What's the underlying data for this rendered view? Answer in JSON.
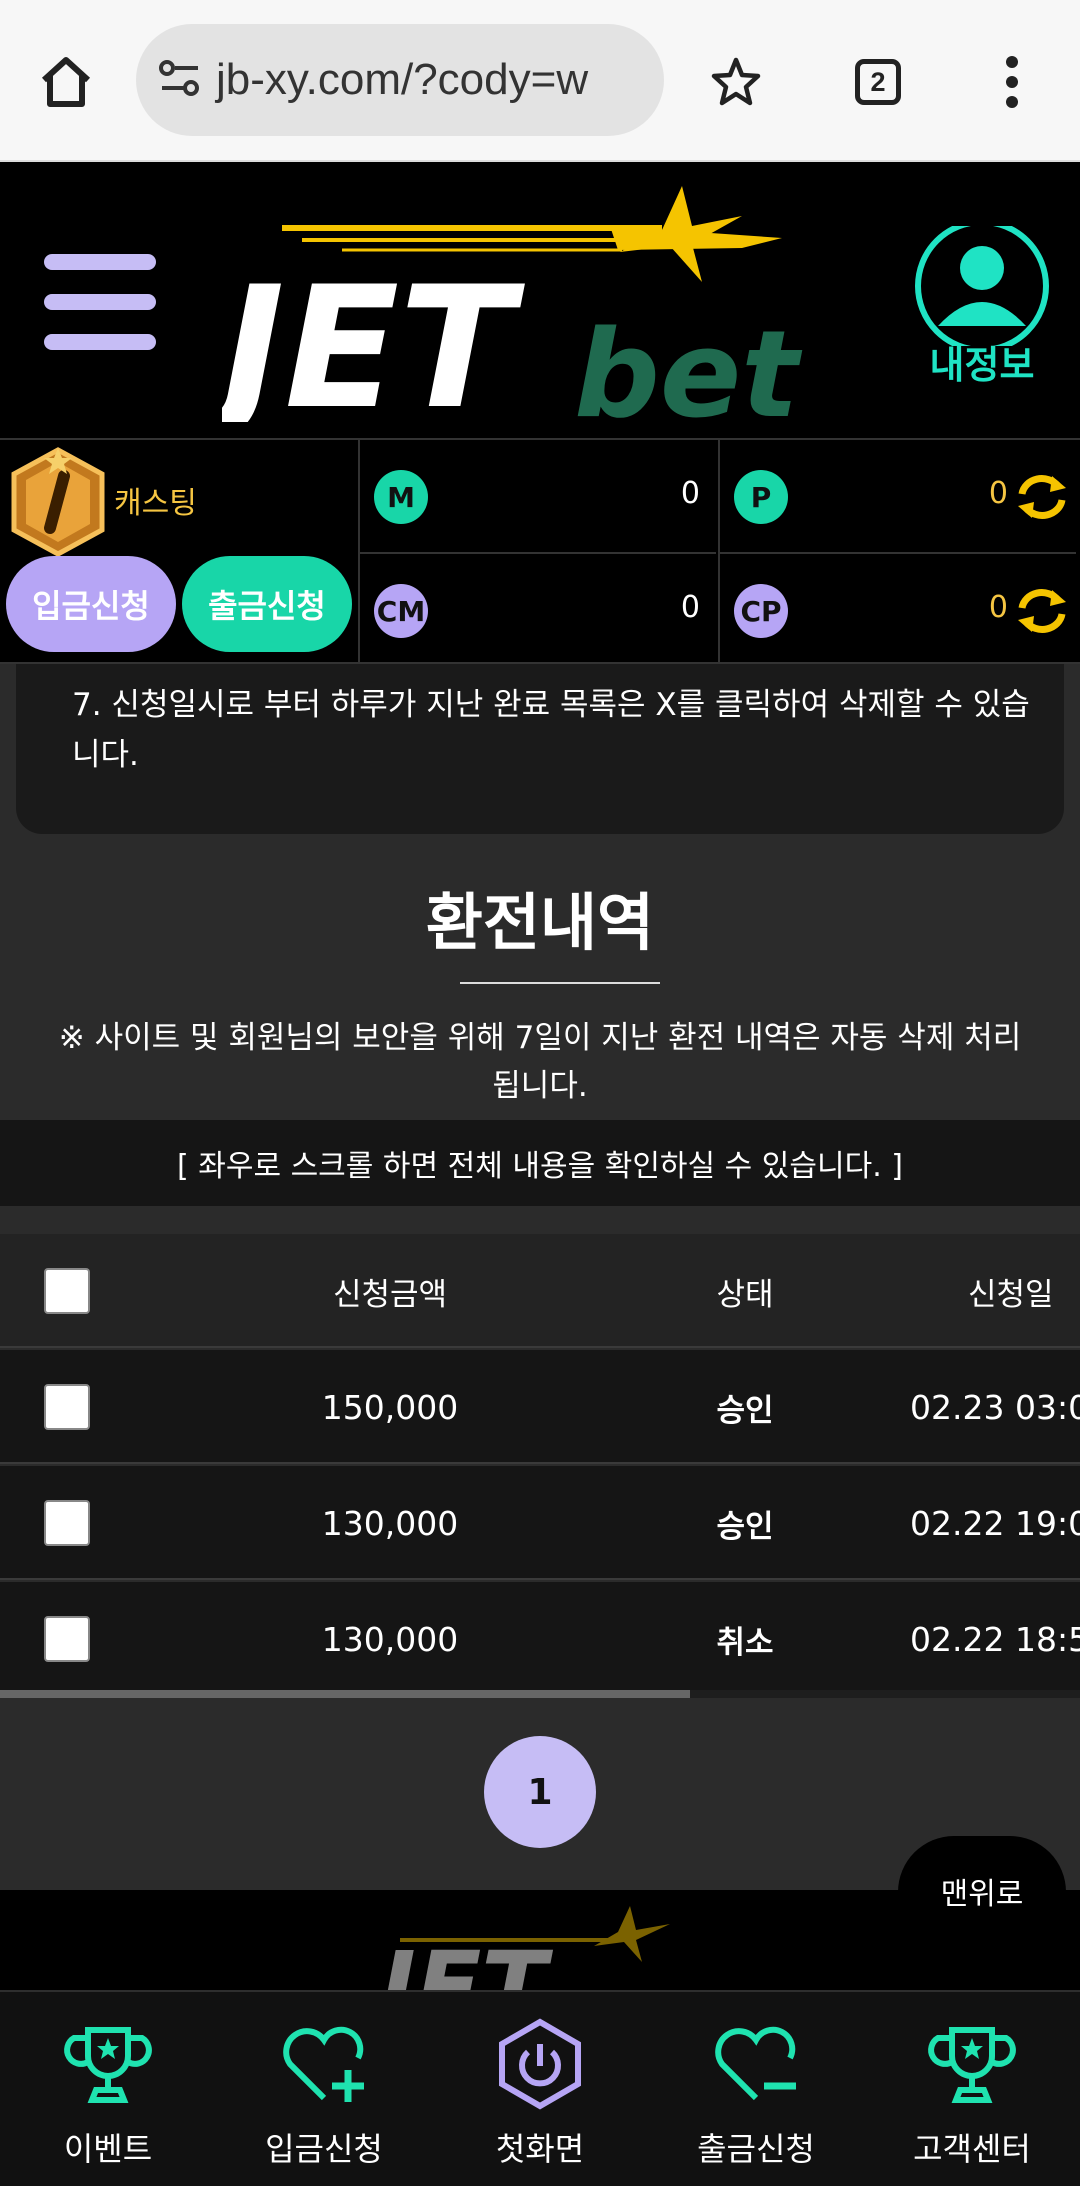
{
  "browser": {
    "url": "jb-xy.com/?cody=w",
    "tab_count": "2",
    "icons": [
      "home-icon",
      "site-info-icon",
      "star-icon",
      "tabs-icon",
      "more-icon"
    ]
  },
  "header": {
    "logo_text_main": "JET",
    "logo_text_sub": "bet",
    "profile_label": "내정보"
  },
  "user_bar": {
    "rank_label": "캐스팅",
    "deposit_button": "입금신청",
    "withdraw_button": "출금신청",
    "balances": [
      {
        "code": "M",
        "value": "0"
      },
      {
        "code": "P",
        "value": "0"
      },
      {
        "code": "CM",
        "value": "0"
      },
      {
        "code": "CP",
        "value": "0"
      }
    ]
  },
  "notice": {
    "text": "7. 신청일시로 부터 하루가 지난 완료 목록은 X를 클릭하여 삭제할 수 있습니다."
  },
  "section": {
    "title": "환전내역",
    "security_note": "※ 사이트 및 회원님의 보안을 위해 7일이 지난 환전 내역은 자동 삭제 처리 됩니다.",
    "scroll_notice": "[ 좌우로 스크롤 하면 전체 내용을 확인하실 수 있습니다. ]"
  },
  "table": {
    "headers": {
      "amount": "신청금액",
      "status": "상태",
      "date": "신청일"
    },
    "rows": [
      {
        "amount": "150,000",
        "status": "승인",
        "date": "02.23 03:0"
      },
      {
        "amount": "130,000",
        "status": "승인",
        "date": "02.22 19:0"
      },
      {
        "amount": "130,000",
        "status": "취소",
        "date": "02.22 18:5"
      }
    ]
  },
  "pagination": {
    "current": "1"
  },
  "to_top_label": "맨위로",
  "bottom_nav": [
    {
      "label": "이벤트",
      "icon": "trophy-icon"
    },
    {
      "label": "입금신청",
      "icon": "heart-plus-icon"
    },
    {
      "label": "첫화면",
      "icon": "power-icon"
    },
    {
      "label": "출금신청",
      "icon": "heart-minus-icon"
    },
    {
      "label": "고객센터",
      "icon": "trophy-icon"
    }
  ],
  "colors": {
    "accent_green": "#18d6a8",
    "accent_purple": "#b6a5f5",
    "gold": "#f5c542",
    "background": "#2b2b2b"
  }
}
